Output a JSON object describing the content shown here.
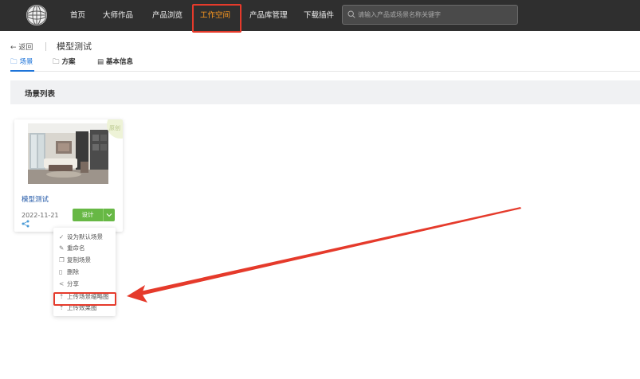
{
  "nav": {
    "logo_icon": "globe-logo-icon",
    "items": [
      {
        "label": "首页"
      },
      {
        "label": "大师作品"
      },
      {
        "label": "产品浏览"
      },
      {
        "label": "工作空间"
      },
      {
        "label": "产品库管理"
      },
      {
        "label": "下载插件"
      }
    ],
    "active_item": "工作空间",
    "search_placeholder": "请输入产品或场景名称关键字"
  },
  "header": {
    "back_label": "返回",
    "title": "模型测试"
  },
  "tabs": [
    {
      "label": "场景",
      "icon": "folder-icon"
    },
    {
      "label": "方案",
      "icon": "folder-icon"
    },
    {
      "label": "基本信息",
      "icon": "document-icon"
    }
  ],
  "section": {
    "title": "场景列表"
  },
  "card": {
    "badge": "原创",
    "name": "模型测试",
    "date": "2022-11-21",
    "design_button": "设计"
  },
  "menu": {
    "items": [
      {
        "label": "设为默认场景",
        "icon": "check-icon"
      },
      {
        "label": "重命名",
        "icon": "edit-icon"
      },
      {
        "label": "复制场景",
        "icon": "copy-icon"
      },
      {
        "label": "删除",
        "icon": "trash-icon"
      },
      {
        "label": "分享",
        "icon": "share-icon"
      },
      {
        "label": "上传场景缩略图",
        "icon": "upload-icon"
      },
      {
        "label": "上传效果图",
        "icon": "upload-icon"
      }
    ]
  },
  "colors": {
    "topbar": "#2f2f2f",
    "nav_active": "#ff9a1f",
    "accent": "#1e74d9",
    "design_button": "#67b845",
    "annotation_red": "#e53a2b"
  }
}
